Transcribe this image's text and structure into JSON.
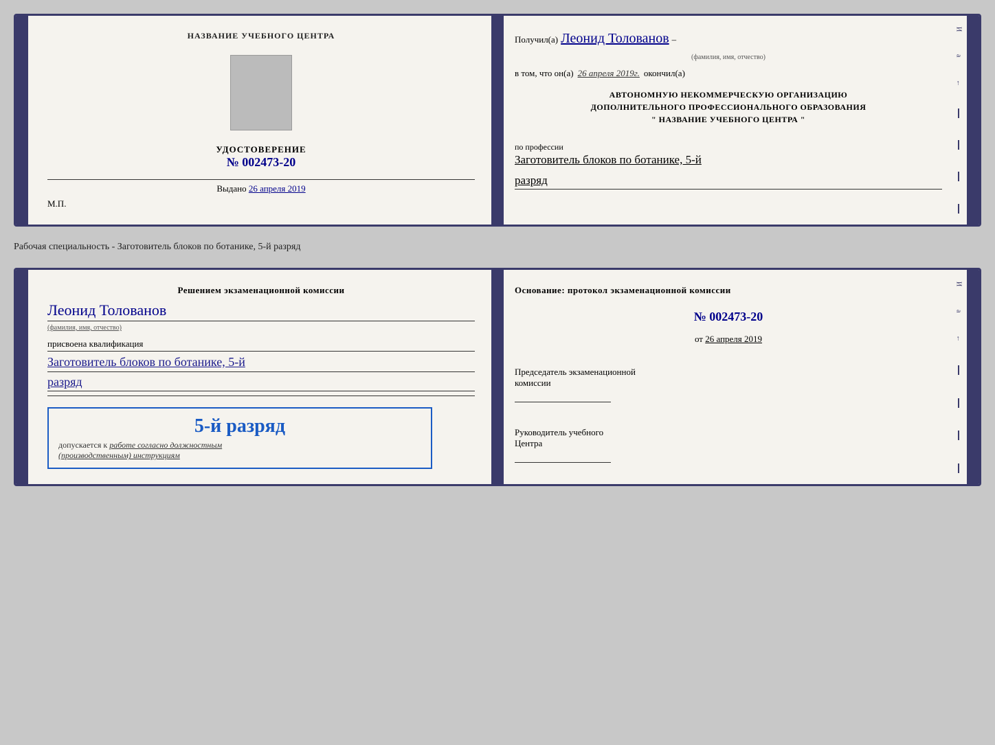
{
  "card1": {
    "left": {
      "top_label": "НАЗВАНИЕ УЧЕБНОГО ЦЕНТРА",
      "cert_title": "УДОСТОВЕРЕНИЕ",
      "cert_number": "№ 002473-20",
      "issued_prefix": "Выдано",
      "issued_date": "26 апреля 2019",
      "mp_label": "М.П."
    },
    "right": {
      "received_prefix": "Получил(а)",
      "person_name": "Леонид Толованов",
      "person_sublabel": "(фамилия, имя, отчество)",
      "dash": "–",
      "date_prefix": "в том, что он(а)",
      "date_value": "26 апреля 2019г.",
      "finished_label": "окончил(а)",
      "org_line1": "АВТОНОМНУЮ НЕКОММЕРЧЕСКУЮ ОРГАНИЗАЦИЮ",
      "org_line2": "ДОПОЛНИТЕЛЬНОГО ПРОФЕССИОНАЛЬНОГО ОБРАЗОВАНИЯ",
      "org_line3": "\"   НАЗВАНИЕ УЧЕБНОГО ЦЕНТРА   \"",
      "profession_prefix": "по профессии",
      "profession_value": "Заготовитель блоков по ботанике, 5-й",
      "razryad_value": "разряд",
      "right_marks": [
        "И",
        "а",
        "←",
        "–",
        "–",
        "–",
        "–"
      ]
    }
  },
  "between_label": "Рабочая специальность - Заготовитель блоков по ботанике, 5-й разряд",
  "card2": {
    "left": {
      "commission_header": "Решением экзаменационной комиссии",
      "person_name": "Леонид Толованов",
      "person_sublabel": "(фамилия, имя, отчество)",
      "qualif_prefix": "присвоена квалификация",
      "qualif_value": "Заготовитель блоков по ботанике, 5-й",
      "razryad_value": "разряд",
      "stamp_rank": "5-й разряд",
      "stamp_prefix": "допускается к",
      "stamp_underline": "работе согласно должностным",
      "stamp_italic": "(производственным) инструкциям"
    },
    "right": {
      "osnov_label": "Основание: протокол экзаменационной комиссии",
      "protocol_num": "№  002473-20",
      "ot_prefix": "от",
      "ot_date": "26 апреля 2019",
      "chairman_line1": "Председатель экзаменационной",
      "chairman_line2": "комиссии",
      "head_line1": "Руководитель учебного",
      "head_line2": "Центра",
      "right_marks": [
        "И",
        "а",
        "←",
        "–",
        "–",
        "–",
        "–"
      ]
    }
  }
}
